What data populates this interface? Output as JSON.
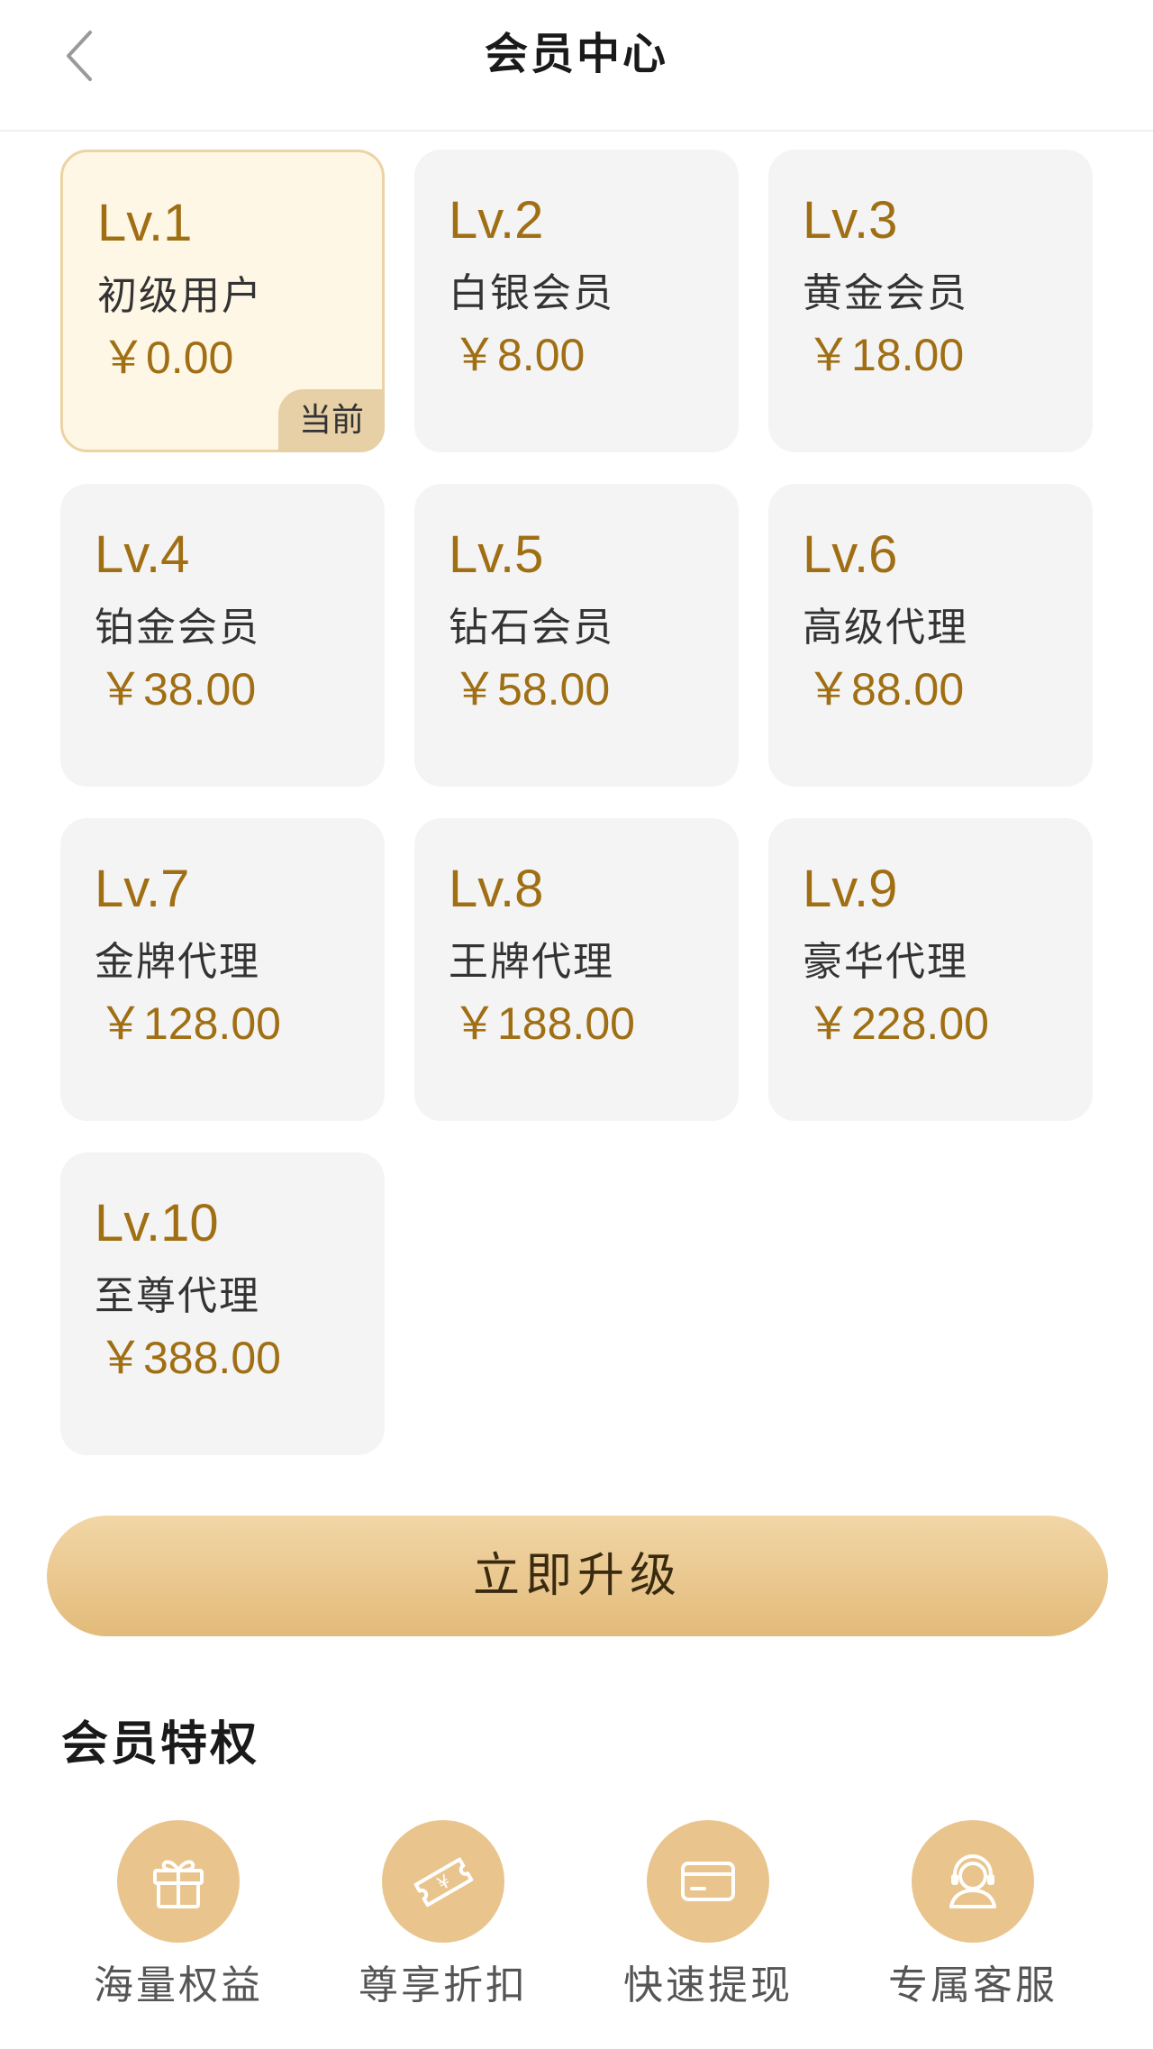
{
  "header": {
    "title": "会员中心",
    "back_icon": "chevron-left-icon"
  },
  "levels": [
    {
      "level": "Lv.1",
      "name": "初级用户",
      "price": "￥0.00",
      "current": true,
      "badge": "当前"
    },
    {
      "level": "Lv.2",
      "name": "白银会员",
      "price": "￥8.00"
    },
    {
      "level": "Lv.3",
      "name": "黄金会员",
      "price": "￥18.00"
    },
    {
      "level": "Lv.4",
      "name": "铂金会员",
      "price": "￥38.00"
    },
    {
      "level": "Lv.5",
      "name": "钻石会员",
      "price": "￥58.00"
    },
    {
      "level": "Lv.6",
      "name": "高级代理",
      "price": "￥88.00"
    },
    {
      "level": "Lv.7",
      "name": "金牌代理",
      "price": "￥128.00"
    },
    {
      "level": "Lv.8",
      "name": "王牌代理",
      "price": "￥188.00"
    },
    {
      "level": "Lv.9",
      "name": "豪华代理",
      "price": "￥228.00"
    },
    {
      "level": "Lv.10",
      "name": "至尊代理",
      "price": "￥388.00"
    }
  ],
  "upgrade_button": "立即升级",
  "privileges": {
    "title": "会员特权",
    "items": [
      {
        "label": "海量权益",
        "icon": "gift-icon"
      },
      {
        "label": "尊享折扣",
        "icon": "coupon-icon"
      },
      {
        "label": "快速提现",
        "icon": "card-icon"
      },
      {
        "label": "专属客服",
        "icon": "customer-service-icon"
      }
    ]
  },
  "colors": {
    "accent_gold": "#a06f14",
    "button_gradient_top": "#f2d6a6",
    "button_gradient_bottom": "#e2bb7a",
    "icon_circle": "#e9c58d",
    "current_card_bg": "#fff7e6",
    "card_bg": "#f4f4f4"
  }
}
